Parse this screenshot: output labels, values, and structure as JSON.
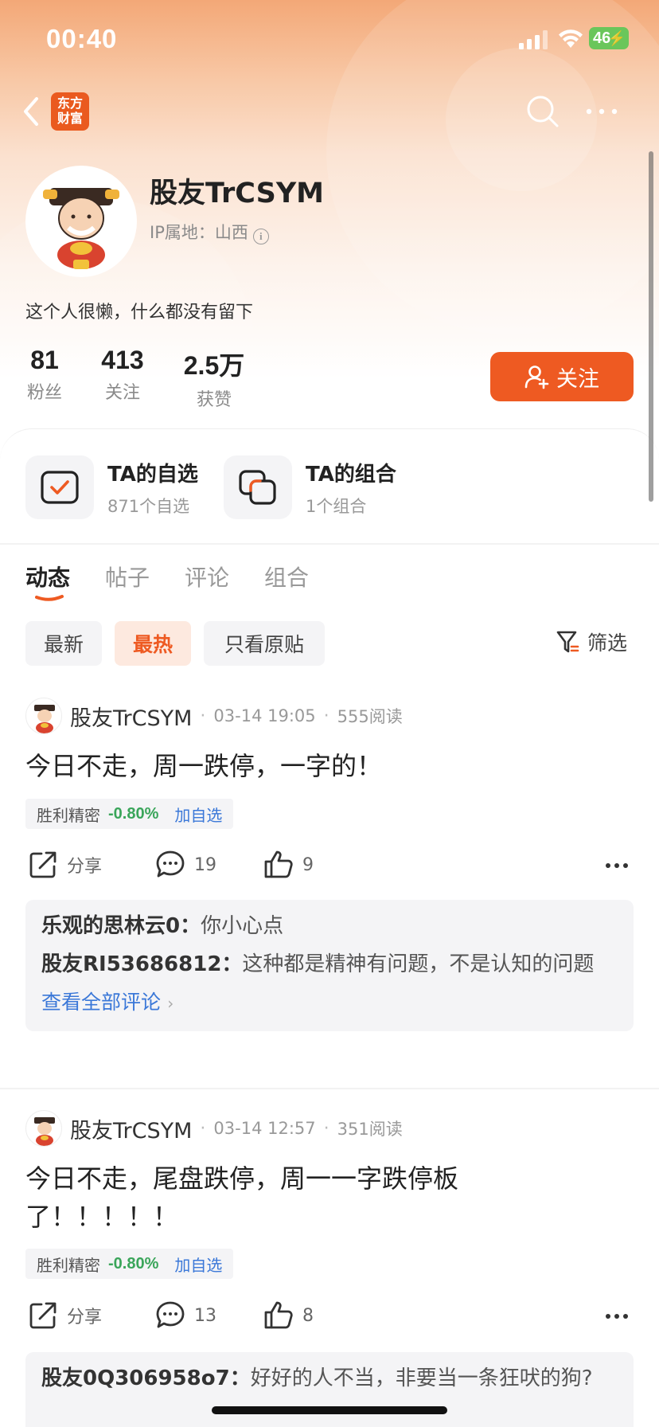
{
  "status_bar": {
    "time": "00:40",
    "battery": "46"
  },
  "nav": {
    "logo_text": "东方财富"
  },
  "profile": {
    "username": "股友TrCSYM",
    "ip_location": "IP属地：山西",
    "bio": "这个人很懒，什么都没有留下",
    "stats": [
      {
        "value": "81",
        "label": "粉丝"
      },
      {
        "value": "413",
        "label": "关注"
      },
      {
        "value": "2.5万",
        "label": "获赞"
      }
    ],
    "follow_label": "关注"
  },
  "ta_cards": [
    {
      "title": "TA的自选",
      "subtitle": "871个自选"
    },
    {
      "title": "TA的组合",
      "subtitle": "1个组合"
    }
  ],
  "tabs": [
    "动态",
    "帖子",
    "评论",
    "组合"
  ],
  "filters": {
    "chips": [
      "最新",
      "最热",
      "只看原贴"
    ],
    "filter_label": "筛选"
  },
  "posts": [
    {
      "author": "股友TrCSYM",
      "time": "03-14 19:05",
      "reads": "555阅读",
      "body": "今日不走，周一跌停，一字的！",
      "stock": {
        "name": "胜利精密",
        "change": "-0.80%",
        "add_label": "加自选"
      },
      "share_label": "分享",
      "comments": "19",
      "likes": "9",
      "comment_list": [
        {
          "author": "乐观的思林云0：",
          "text": "你小心点"
        },
        {
          "author": "股友RI53686812：",
          "text": "这种都是精神有问题，不是认知的问题"
        }
      ],
      "view_all": "查看全部评论"
    },
    {
      "author": "股友TrCSYM",
      "time": "03-14 12:57",
      "reads": "351阅读",
      "body": "今日不走，尾盘跌停，周一一字跌停板了！！！！！",
      "stock": {
        "name": "胜利精密",
        "change": "-0.80%",
        "add_label": "加自选"
      },
      "share_label": "分享",
      "comments": "13",
      "likes": "8",
      "comment_list": [
        {
          "author": "股友0Q306958o7：",
          "text": "好好的人不当，非要当一条狂吠的狗?"
        }
      ]
    }
  ],
  "colors": {
    "accent": "#ee5a22",
    "rise_fall_green": "#3aa55a",
    "link_blue": "#3b78d8"
  }
}
